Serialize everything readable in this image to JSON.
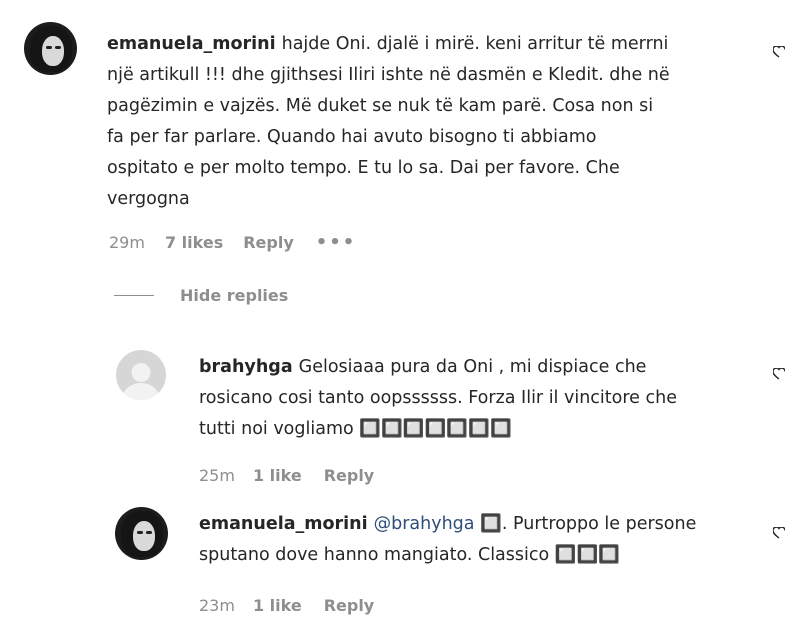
{
  "comments": [
    {
      "username": "emanuela_morini",
      "avatar": "woman-photo",
      "text_lines": [
        "hajde Oni. djalë i mirë. keni arritur të merrni",
        "një artikull !!! dhe gjithsesi Iliri ishte në dasmën e Kledit. dhe në",
        "pagëzimin e vajzës. Më duket se nuk të kam parë. Cosa non si",
        "fa per far parlare. Quando hai avuto bisogno ti abbiamo",
        "ospitato e per molto tempo. E tu lo sa. Dai per favore. Che",
        "vergogna"
      ],
      "time": "29m",
      "likes": "7 likes",
      "reply": "Reply",
      "more": "•••"
    }
  ],
  "hide_replies": "Hide replies",
  "replies": [
    {
      "username": "brahyhga",
      "avatar": "default-avatar",
      "text_lines": [
        "Gelosiaaa pura da Oni , mi dispiace che",
        "rosicano cosi tanto oopssssss. Forza Ilir il vincitore che",
        "tutti noi vogliamo 🔲🔲🔲🔲🔲🔲🔲"
      ],
      "time": "25m",
      "likes": "1 like",
      "reply": "Reply"
    },
    {
      "username": "emanuela_morini",
      "avatar": "woman-photo",
      "mention": "@brahyhga",
      "text_lines": [
        " 🔲. Purtroppo le persone",
        "sputano dove hanno mangiato. Classico 🔲🔲🔲"
      ],
      "time": "23m",
      "likes": "1 like",
      "reply": "Reply"
    }
  ],
  "icons": [
    "heart-icon",
    "more-options-icon",
    "default-avatar-icon"
  ],
  "colors": {
    "text": "#262626",
    "muted": "#8e8e8e",
    "mention": "#2f4d7a",
    "background": "#ffffff"
  }
}
